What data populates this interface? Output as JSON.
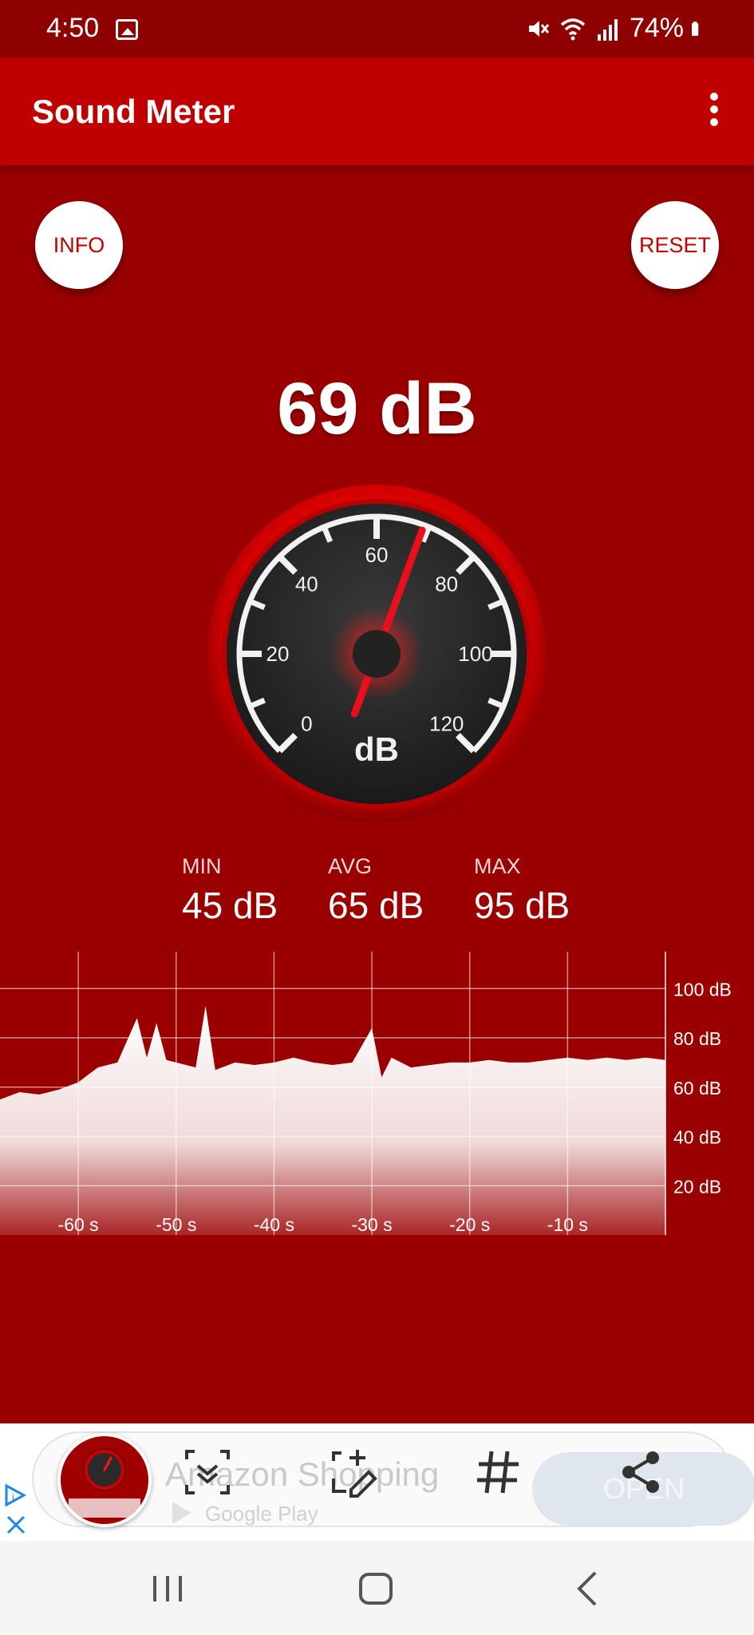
{
  "status_bar": {
    "time": "4:50",
    "battery": "74%",
    "icons": [
      "image-icon",
      "mute-icon",
      "wifi-icon",
      "signal-icon",
      "battery-icon"
    ]
  },
  "app_bar": {
    "title": "Sound Meter",
    "menu_icon": "more-vert-icon"
  },
  "buttons": {
    "info": "INFO",
    "reset": "RESET"
  },
  "reading": "69 dB",
  "gauge": {
    "unit": "dB",
    "labels": [
      "0",
      "20",
      "40",
      "60",
      "80",
      "100",
      "120"
    ],
    "min": 0,
    "max": 120,
    "value": 69
  },
  "stats": {
    "min_label": "MIN",
    "min_value": "45 dB",
    "avg_label": "AVG",
    "avg_value": "65 dB",
    "max_label": "MAX",
    "max_value": "95 dB"
  },
  "graph": {
    "y_labels": [
      "100 dB",
      "80 dB",
      "60 dB",
      "40 dB",
      "20 dB"
    ],
    "x_labels": [
      "-60 s",
      "-50 s",
      "-40 s",
      "-30 s",
      "-20 s",
      "-10 s"
    ]
  },
  "chart_data": {
    "type": "area",
    "x": [
      -68,
      -66,
      -64,
      -62,
      -60,
      -58,
      -56,
      -54,
      -53,
      -52,
      -51,
      -50,
      -48,
      -47,
      -46,
      -44,
      -42,
      -40,
      -38,
      -36,
      -34,
      -32,
      -30,
      -29,
      -28,
      -26,
      -24,
      -22,
      -20,
      -18,
      -16,
      -14,
      -12,
      -10,
      -8,
      -6,
      -4,
      -2,
      0
    ],
    "values": [
      55,
      58,
      57,
      59,
      62,
      68,
      70,
      88,
      72,
      86,
      71,
      70,
      68,
      93,
      67,
      70,
      69,
      70,
      72,
      70,
      69,
      70,
      84,
      64,
      72,
      68,
      69,
      70,
      70,
      71,
      70,
      70,
      71,
      72,
      71,
      72,
      71,
      72,
      71
    ],
    "xlabel": "",
    "ylabel": "",
    "ylim": [
      0,
      115
    ],
    "grid": true
  },
  "ad": {
    "title": "Amazon Shopping",
    "subtitle": "Google Play",
    "open_label": "OPEN"
  },
  "colors": {
    "background": "#9b0000",
    "app_bar": "#c00000",
    "needle": "#e8101a"
  }
}
